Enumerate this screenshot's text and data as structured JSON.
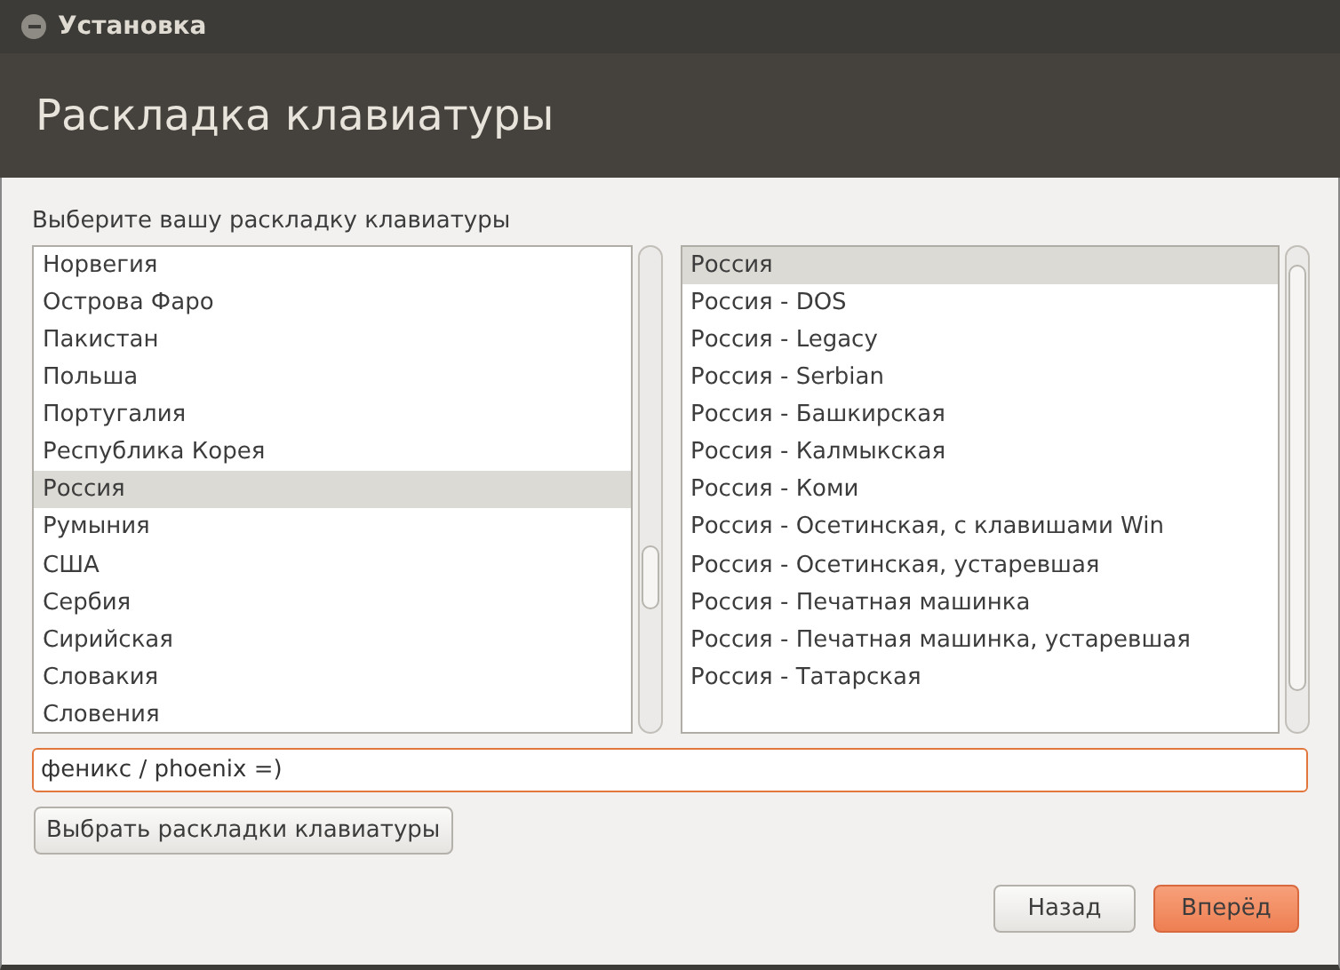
{
  "window": {
    "title": "Установка"
  },
  "header": {
    "title": "Раскладка клавиатуры"
  },
  "prompt": "Выберите вашу раскладку клавиатуры",
  "layouts": [
    {
      "label": "Норвегия",
      "selected": false
    },
    {
      "label": "Острова Фаро",
      "selected": false
    },
    {
      "label": "Пакистан",
      "selected": false
    },
    {
      "label": "Польша",
      "selected": false
    },
    {
      "label": "Португалия",
      "selected": false
    },
    {
      "label": "Республика Корея",
      "selected": false
    },
    {
      "label": "Россия",
      "selected": true
    },
    {
      "label": "Румыния",
      "selected": false
    },
    {
      "label": "США",
      "selected": false
    },
    {
      "label": "Сербия",
      "selected": false
    },
    {
      "label": "Сирийская",
      "selected": false
    },
    {
      "label": "Словакия",
      "selected": false
    },
    {
      "label": "Словения",
      "selected": false
    }
  ],
  "variants": [
    {
      "label": "Россия",
      "selected": true
    },
    {
      "label": "Россия - DOS",
      "selected": false
    },
    {
      "label": "Россия - Legacy",
      "selected": false
    },
    {
      "label": "Россия - Serbian",
      "selected": false
    },
    {
      "label": "Россия - Башкирская",
      "selected": false
    },
    {
      "label": "Россия - Калмыкская",
      "selected": false
    },
    {
      "label": "Россия - Коми",
      "selected": false
    },
    {
      "label": "Россия - Осетинская, с клавишами Win",
      "selected": false
    },
    {
      "label": "Россия - Осетинская, устаревшая",
      "selected": false
    },
    {
      "label": "Россия - Печатная машинка",
      "selected": false
    },
    {
      "label": "Россия - Печатная машинка, устаревшая",
      "selected": false
    },
    {
      "label": "Россия - Татарская",
      "selected": false
    }
  ],
  "test_field": {
    "value": "феникс / phoenix =)"
  },
  "detect_button": "Выбрать раскладки клавиатуры",
  "buttons": [
    {
      "label": "Назад",
      "kind": "secondary"
    },
    {
      "label": "Вперёд",
      "kind": "primary"
    }
  ]
}
